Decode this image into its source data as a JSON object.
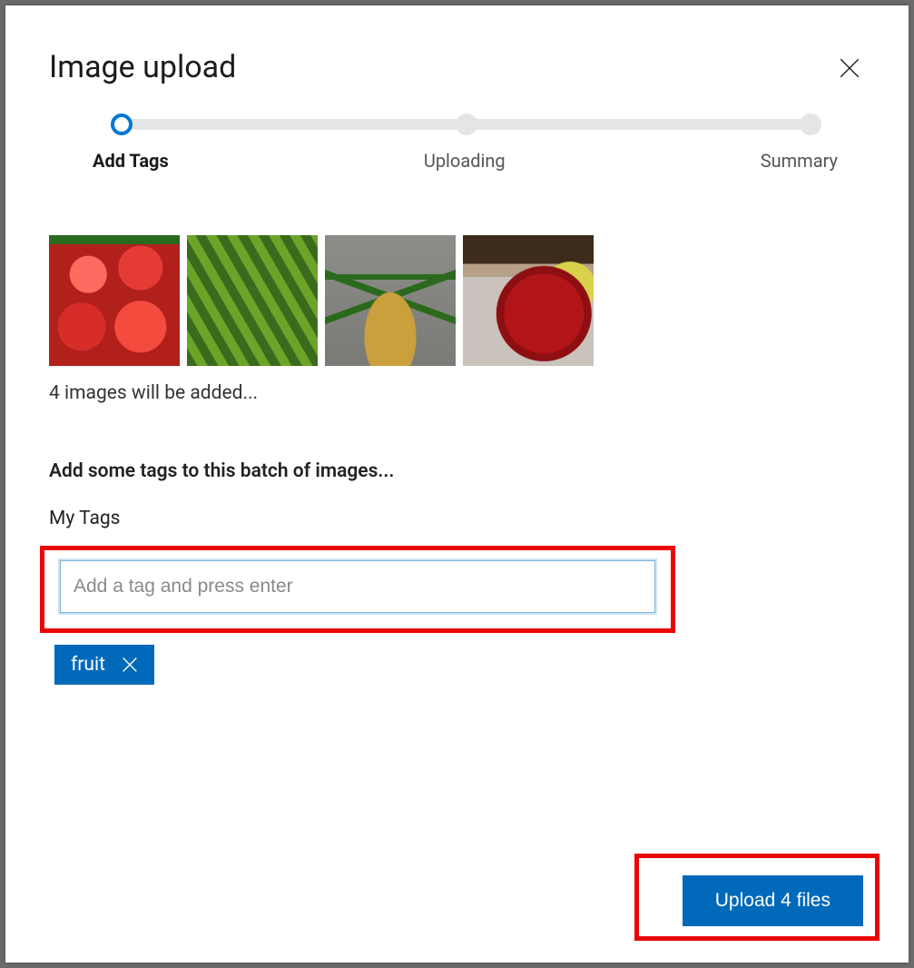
{
  "dialog": {
    "title": "Image upload"
  },
  "stepper": {
    "steps": [
      {
        "label": "Add Tags",
        "active": true
      },
      {
        "label": "Uploading",
        "active": false
      },
      {
        "label": "Summary",
        "active": false
      }
    ]
  },
  "thumbnails": {
    "count": 4,
    "status": "4 images will be added..."
  },
  "tags": {
    "prompt": "Add some tags to this batch of images...",
    "section_label": "My Tags",
    "input_placeholder": "Add a tag and press enter",
    "chips": [
      {
        "label": "fruit"
      }
    ]
  },
  "actions": {
    "upload_label": "Upload 4 files"
  }
}
